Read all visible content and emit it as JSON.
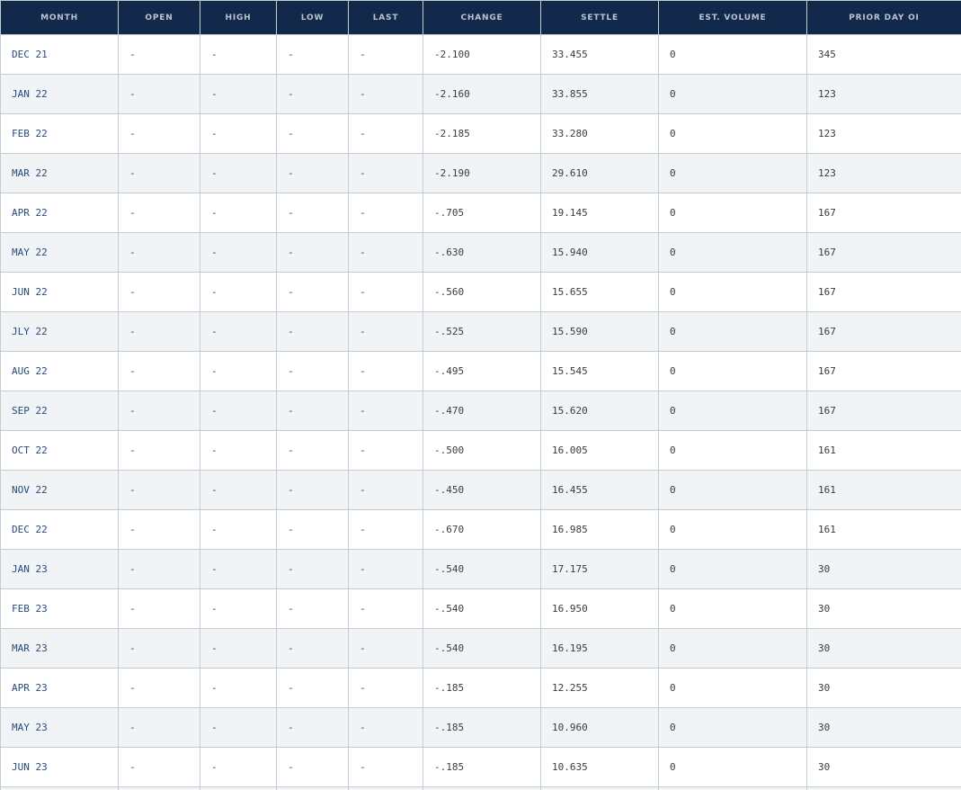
{
  "table": {
    "headers": [
      "MONTH",
      "OPEN",
      "HIGH",
      "LOW",
      "LAST",
      "CHANGE",
      "SETTLE",
      "EST. VOLUME",
      "PRIOR DAY OI"
    ],
    "rows": [
      [
        "DEC 21",
        "-",
        "-",
        "-",
        "-",
        "-2.100",
        "33.455",
        "0",
        "345"
      ],
      [
        "JAN 22",
        "-",
        "-",
        "-",
        "-",
        "-2.160",
        "33.855",
        "0",
        "123"
      ],
      [
        "FEB 22",
        "-",
        "-",
        "-",
        "-",
        "-2.185",
        "33.280",
        "0",
        "123"
      ],
      [
        "MAR 22",
        "-",
        "-",
        "-",
        "-",
        "-2.190",
        "29.610",
        "0",
        "123"
      ],
      [
        "APR 22",
        "-",
        "-",
        "-",
        "-",
        "-.705",
        "19.145",
        "0",
        "167"
      ],
      [
        "MAY 22",
        "-",
        "-",
        "-",
        "-",
        "-.630",
        "15.940",
        "0",
        "167"
      ],
      [
        "JUN 22",
        "-",
        "-",
        "-",
        "-",
        "-.560",
        "15.655",
        "0",
        "167"
      ],
      [
        "JLY 22",
        "-",
        "-",
        "-",
        "-",
        "-.525",
        "15.590",
        "0",
        "167"
      ],
      [
        "AUG 22",
        "-",
        "-",
        "-",
        "-",
        "-.495",
        "15.545",
        "0",
        "167"
      ],
      [
        "SEP 22",
        "-",
        "-",
        "-",
        "-",
        "-.470",
        "15.620",
        "0",
        "167"
      ],
      [
        "OCT 22",
        "-",
        "-",
        "-",
        "-",
        "-.500",
        "16.005",
        "0",
        "161"
      ],
      [
        "NOV 22",
        "-",
        "-",
        "-",
        "-",
        "-.450",
        "16.455",
        "0",
        "161"
      ],
      [
        "DEC 22",
        "-",
        "-",
        "-",
        "-",
        "-.670",
        "16.985",
        "0",
        "161"
      ],
      [
        "JAN 23",
        "-",
        "-",
        "-",
        "-",
        "-.540",
        "17.175",
        "0",
        "30"
      ],
      [
        "FEB 23",
        "-",
        "-",
        "-",
        "-",
        "-.540",
        "16.950",
        "0",
        "30"
      ],
      [
        "MAR 23",
        "-",
        "-",
        "-",
        "-",
        "-.540",
        "16.195",
        "0",
        "30"
      ],
      [
        "APR 23",
        "-",
        "-",
        "-",
        "-",
        "-.185",
        "12.255",
        "0",
        "30"
      ],
      [
        "MAY 23",
        "-",
        "-",
        "-",
        "-",
        "-.185",
        "10.960",
        "0",
        "30"
      ],
      [
        "JUN 23",
        "-",
        "-",
        "-",
        "-",
        "-.185",
        "10.635",
        "0",
        "30"
      ]
    ]
  }
}
